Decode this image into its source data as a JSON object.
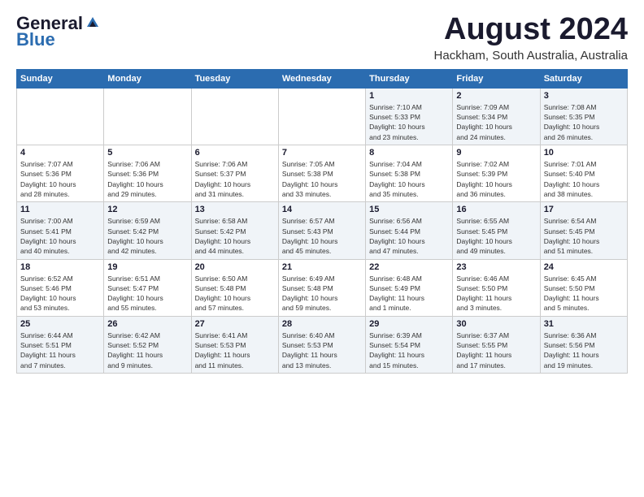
{
  "header": {
    "logo_general": "General",
    "logo_blue": "Blue",
    "month_title": "August 2024",
    "location": "Hackham, South Australia, Australia"
  },
  "calendar": {
    "days_of_week": [
      "Sunday",
      "Monday",
      "Tuesday",
      "Wednesday",
      "Thursday",
      "Friday",
      "Saturday"
    ],
    "weeks": [
      [
        {
          "day": "",
          "detail": ""
        },
        {
          "day": "",
          "detail": ""
        },
        {
          "day": "",
          "detail": ""
        },
        {
          "day": "",
          "detail": ""
        },
        {
          "day": "1",
          "detail": "Sunrise: 7:10 AM\nSunset: 5:33 PM\nDaylight: 10 hours\nand 23 minutes."
        },
        {
          "day": "2",
          "detail": "Sunrise: 7:09 AM\nSunset: 5:34 PM\nDaylight: 10 hours\nand 24 minutes."
        },
        {
          "day": "3",
          "detail": "Sunrise: 7:08 AM\nSunset: 5:35 PM\nDaylight: 10 hours\nand 26 minutes."
        }
      ],
      [
        {
          "day": "4",
          "detail": "Sunrise: 7:07 AM\nSunset: 5:36 PM\nDaylight: 10 hours\nand 28 minutes."
        },
        {
          "day": "5",
          "detail": "Sunrise: 7:06 AM\nSunset: 5:36 PM\nDaylight: 10 hours\nand 29 minutes."
        },
        {
          "day": "6",
          "detail": "Sunrise: 7:06 AM\nSunset: 5:37 PM\nDaylight: 10 hours\nand 31 minutes."
        },
        {
          "day": "7",
          "detail": "Sunrise: 7:05 AM\nSunset: 5:38 PM\nDaylight: 10 hours\nand 33 minutes."
        },
        {
          "day": "8",
          "detail": "Sunrise: 7:04 AM\nSunset: 5:38 PM\nDaylight: 10 hours\nand 35 minutes."
        },
        {
          "day": "9",
          "detail": "Sunrise: 7:02 AM\nSunset: 5:39 PM\nDaylight: 10 hours\nand 36 minutes."
        },
        {
          "day": "10",
          "detail": "Sunrise: 7:01 AM\nSunset: 5:40 PM\nDaylight: 10 hours\nand 38 minutes."
        }
      ],
      [
        {
          "day": "11",
          "detail": "Sunrise: 7:00 AM\nSunset: 5:41 PM\nDaylight: 10 hours\nand 40 minutes."
        },
        {
          "day": "12",
          "detail": "Sunrise: 6:59 AM\nSunset: 5:42 PM\nDaylight: 10 hours\nand 42 minutes."
        },
        {
          "day": "13",
          "detail": "Sunrise: 6:58 AM\nSunset: 5:42 PM\nDaylight: 10 hours\nand 44 minutes."
        },
        {
          "day": "14",
          "detail": "Sunrise: 6:57 AM\nSunset: 5:43 PM\nDaylight: 10 hours\nand 45 minutes."
        },
        {
          "day": "15",
          "detail": "Sunrise: 6:56 AM\nSunset: 5:44 PM\nDaylight: 10 hours\nand 47 minutes."
        },
        {
          "day": "16",
          "detail": "Sunrise: 6:55 AM\nSunset: 5:45 PM\nDaylight: 10 hours\nand 49 minutes."
        },
        {
          "day": "17",
          "detail": "Sunrise: 6:54 AM\nSunset: 5:45 PM\nDaylight: 10 hours\nand 51 minutes."
        }
      ],
      [
        {
          "day": "18",
          "detail": "Sunrise: 6:52 AM\nSunset: 5:46 PM\nDaylight: 10 hours\nand 53 minutes."
        },
        {
          "day": "19",
          "detail": "Sunrise: 6:51 AM\nSunset: 5:47 PM\nDaylight: 10 hours\nand 55 minutes."
        },
        {
          "day": "20",
          "detail": "Sunrise: 6:50 AM\nSunset: 5:48 PM\nDaylight: 10 hours\nand 57 minutes."
        },
        {
          "day": "21",
          "detail": "Sunrise: 6:49 AM\nSunset: 5:48 PM\nDaylight: 10 hours\nand 59 minutes."
        },
        {
          "day": "22",
          "detail": "Sunrise: 6:48 AM\nSunset: 5:49 PM\nDaylight: 11 hours\nand 1 minute."
        },
        {
          "day": "23",
          "detail": "Sunrise: 6:46 AM\nSunset: 5:50 PM\nDaylight: 11 hours\nand 3 minutes."
        },
        {
          "day": "24",
          "detail": "Sunrise: 6:45 AM\nSunset: 5:50 PM\nDaylight: 11 hours\nand 5 minutes."
        }
      ],
      [
        {
          "day": "25",
          "detail": "Sunrise: 6:44 AM\nSunset: 5:51 PM\nDaylight: 11 hours\nand 7 minutes."
        },
        {
          "day": "26",
          "detail": "Sunrise: 6:42 AM\nSunset: 5:52 PM\nDaylight: 11 hours\nand 9 minutes."
        },
        {
          "day": "27",
          "detail": "Sunrise: 6:41 AM\nSunset: 5:53 PM\nDaylight: 11 hours\nand 11 minutes."
        },
        {
          "day": "28",
          "detail": "Sunrise: 6:40 AM\nSunset: 5:53 PM\nDaylight: 11 hours\nand 13 minutes."
        },
        {
          "day": "29",
          "detail": "Sunrise: 6:39 AM\nSunset: 5:54 PM\nDaylight: 11 hours\nand 15 minutes."
        },
        {
          "day": "30",
          "detail": "Sunrise: 6:37 AM\nSunset: 5:55 PM\nDaylight: 11 hours\nand 17 minutes."
        },
        {
          "day": "31",
          "detail": "Sunrise: 6:36 AM\nSunset: 5:56 PM\nDaylight: 11 hours\nand 19 minutes."
        }
      ]
    ]
  }
}
